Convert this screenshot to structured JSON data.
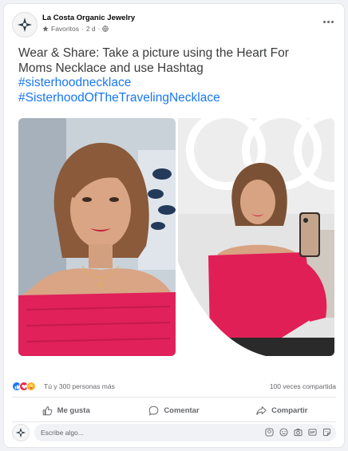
{
  "post": {
    "page_name": "La Costa Organic Jewelry",
    "audience": "Favoritos",
    "time": "2 d",
    "separator": "·",
    "text_line1": "Wear & Share: Take a picture using the Heart For",
    "text_line2": "Moms Necklace and use Hashtag",
    "hashtags": [
      "#sisterhoodnecklace",
      "#SisterhoodOfTheTravelingNecklace"
    ]
  },
  "photos": [
    {
      "icon": "selfie-photo",
      "colors": {
        "bg": "#cfd6dc",
        "hair": "#8a5a3a",
        "skin": "#d9a585",
        "top": "#e0215a"
      }
    },
    {
      "icon": "mirror-selfie-photo",
      "colors": {
        "bg": "#ededed",
        "hair": "#7b5135",
        "skin": "#d8a383",
        "top": "#e11f57"
      }
    }
  ],
  "engagement": {
    "reactions_text": "Tú y 300 personas más",
    "shares_text": "100 veces compartida",
    "reaction_icons": [
      "like-icon",
      "love-icon",
      "care-icon"
    ]
  },
  "actions": {
    "like": "Me gusta",
    "comment": "Comentar",
    "share": "Compartir"
  },
  "comment": {
    "placeholder": "Escribe algo..."
  },
  "colors": {
    "accent": "#1877f2",
    "love": "#f02849",
    "care": "#f7b125"
  }
}
